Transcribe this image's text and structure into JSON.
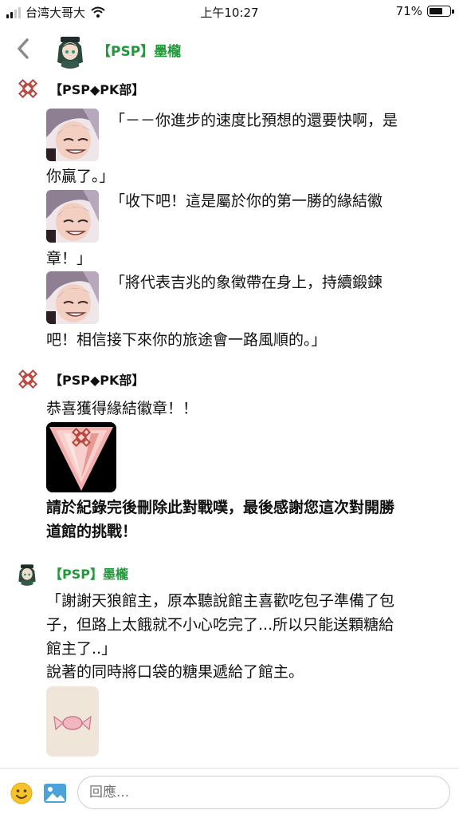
{
  "status": {
    "carrier": "台湾大哥大",
    "time": "上午10:27",
    "battery": "71%",
    "battery_level": 0.71
  },
  "header": {
    "title": "【PSP】墨櫳"
  },
  "messages": {
    "m1": {
      "sender": "【PSP◆PK部】",
      "l1": "「－－你進步的速度比預想的還要快啊，是",
      "l2": "你贏了。」",
      "l3": "「收下吧！這是屬於你的第一勝的緣結徽",
      "l4": "章！」",
      "l5": "「將代表吉兆的象徵帶在身上，持續鍛鍊",
      "l6": "吧！相信接下來你的旅途會一路風順的。」"
    },
    "m2": {
      "sender": "【PSP◆PK部】",
      "l1": "恭喜獲得緣結徽章！！",
      "l2": "請於紀錄完後刪除此對戰噗，最後感謝您這次對開勝",
      "l3": "道館的挑戰！"
    },
    "m3": {
      "sender": "【PSP】墨櫳",
      "l1": "「謝謝天狼館主，原本聽說館主喜歡吃包子準備了包",
      "l2": "子，但路上太餓就不小心吃完了...所以只能送顆糖給",
      "l3": "館主了..」",
      "l4": "說著的同時將口袋的糖果遞給了館主。"
    }
  },
  "input": {
    "placeholder": "回應..."
  },
  "icons": {
    "back": "chevron-left-icon",
    "emoji": "smiley-icon",
    "image": "image-icon",
    "wifi": "wifi-icon"
  },
  "colors": {
    "accent_green": "#1e9a38",
    "knot_red": "#b8453c",
    "emoji_yellow": "#f6c32b",
    "image_blue": "#4da3d9"
  }
}
